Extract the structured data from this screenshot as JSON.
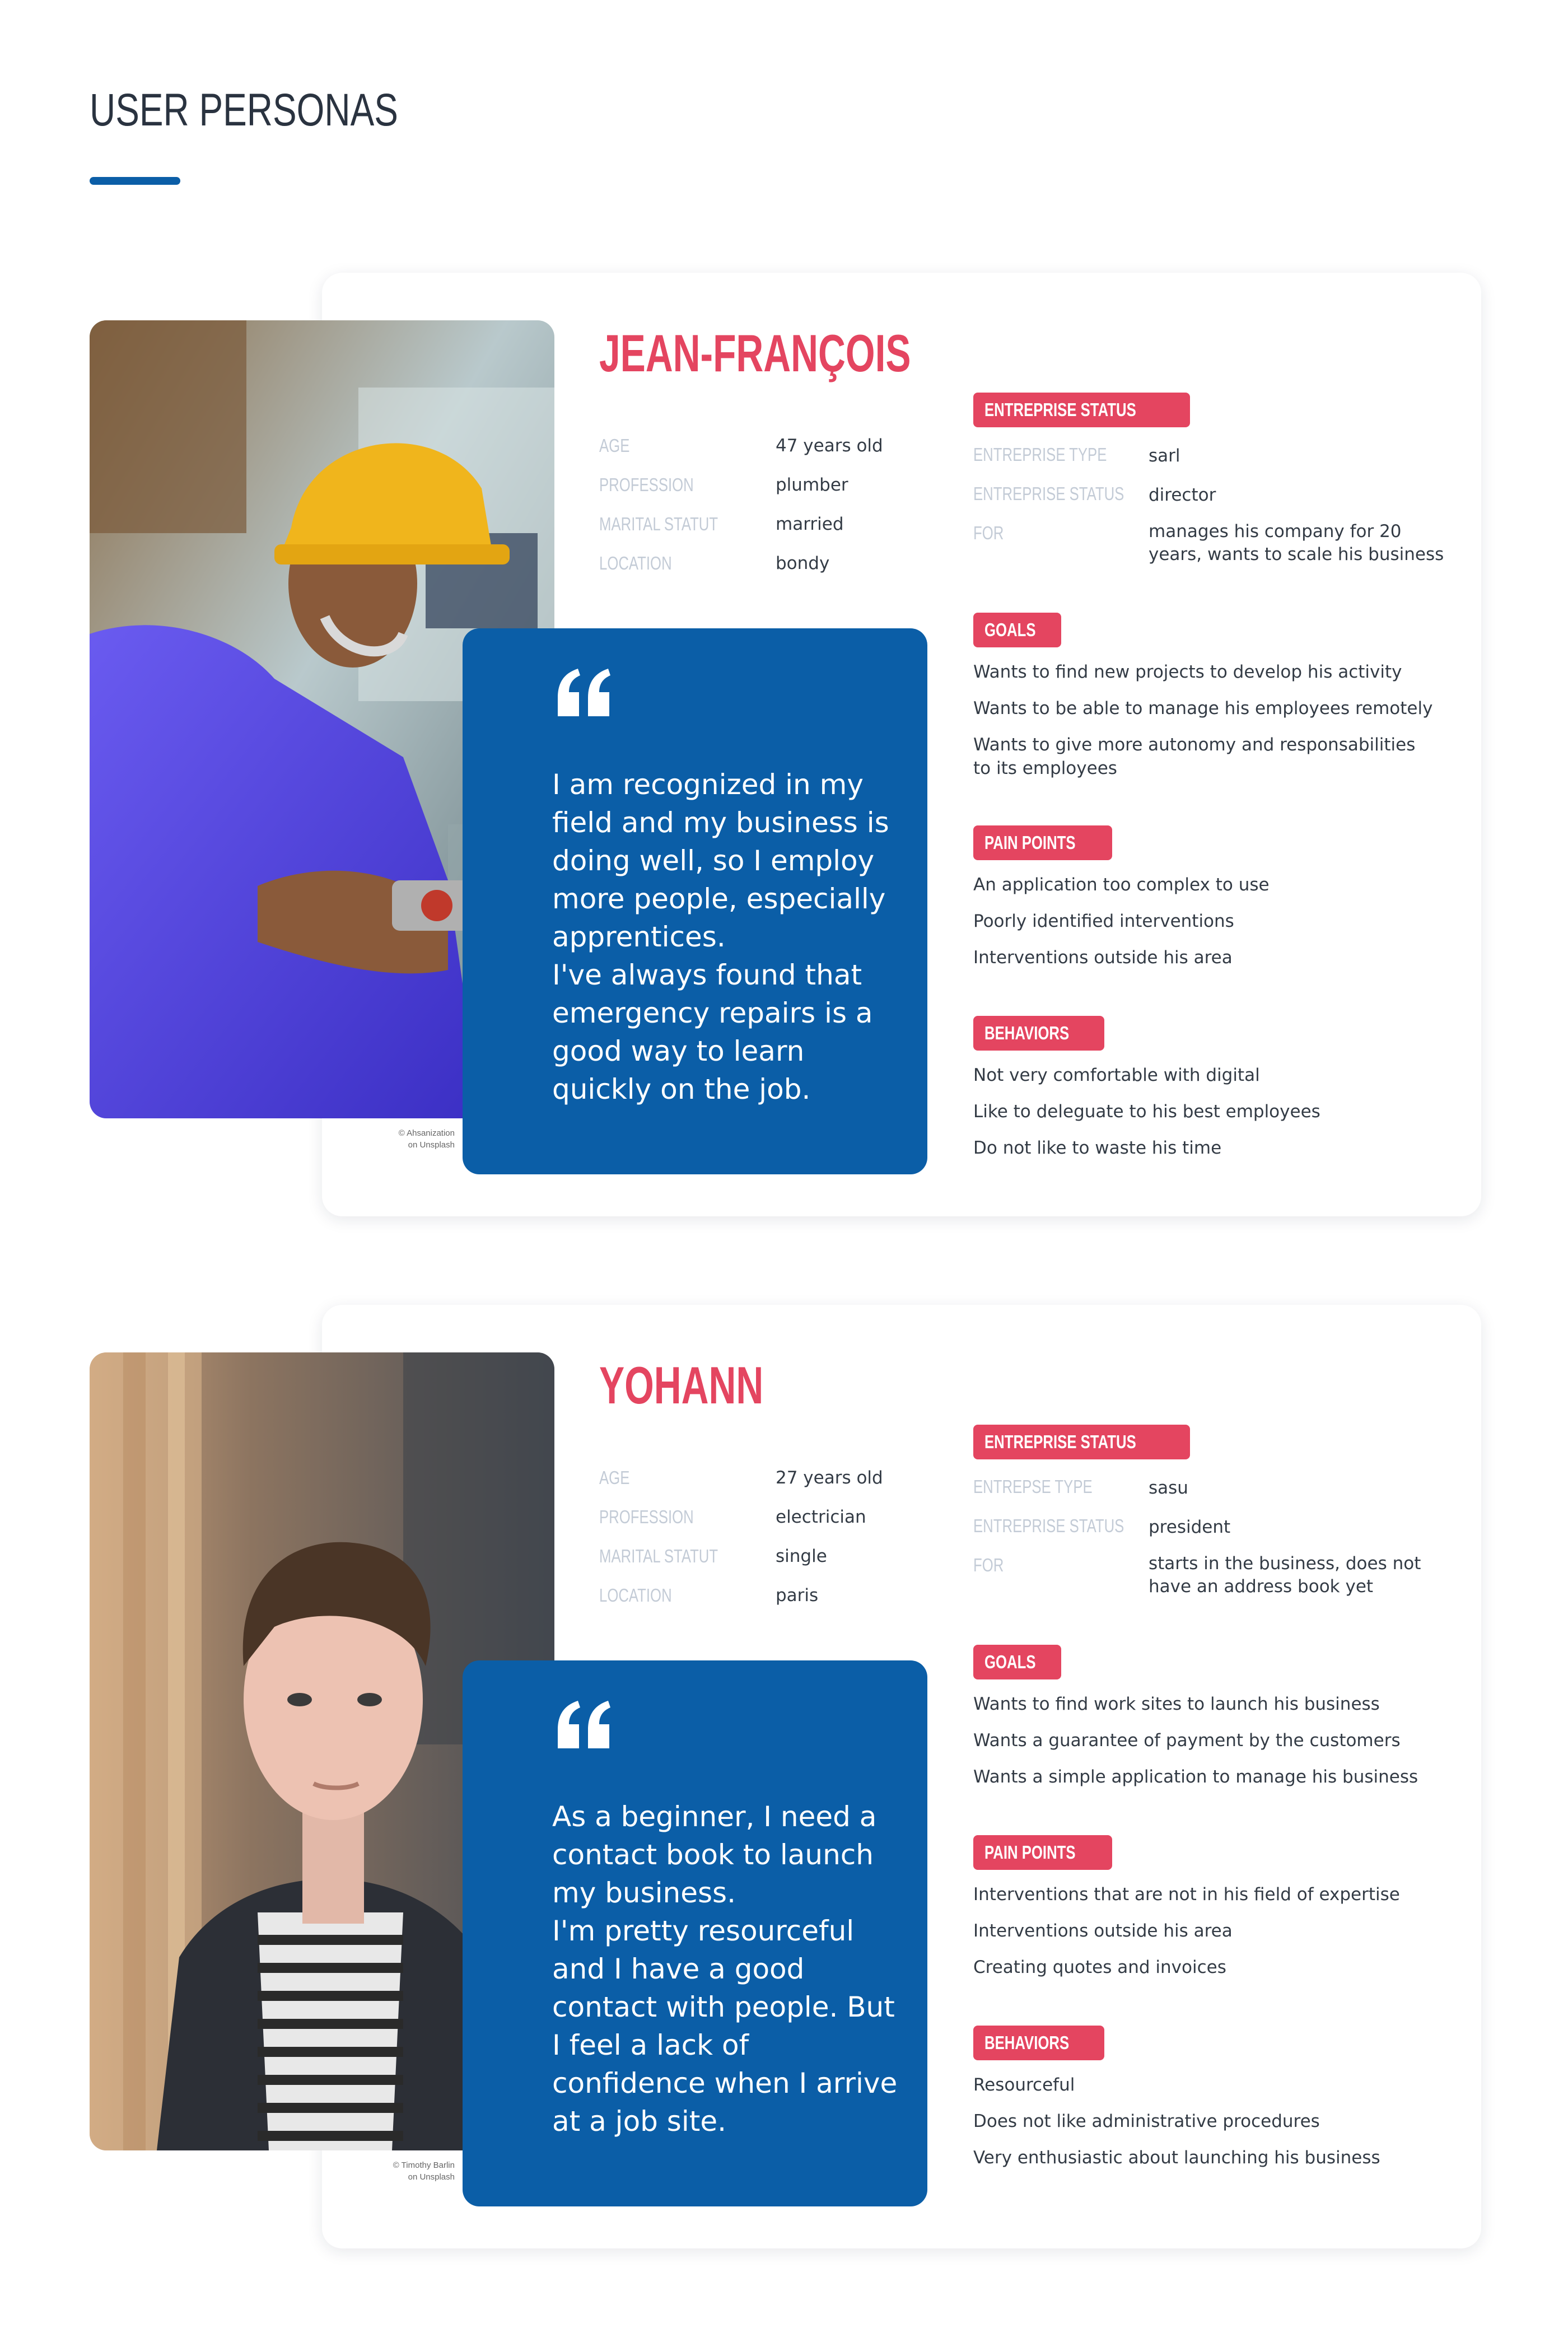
{
  "page": {
    "title": "USER PERSONAS"
  },
  "labels": {
    "age": "AGE",
    "profession": "PROFESSION",
    "marital": "MARITAL STATUT",
    "location": "LOCATION",
    "entreprise_status_tag": "ENTREPRISE STATUS",
    "for": "FOR",
    "goals_tag": "GOALS",
    "pain_points_tag": "PAIN POINTS",
    "behaviors_tag": "BEHAVIORS"
  },
  "personas": [
    {
      "name": "JEAN-FRANÇOIS",
      "age": "47 years old",
      "profession": "plumber",
      "marital": "married",
      "location": "bondy",
      "entreprise_type_label": "ENTREPRISE TYPE",
      "entreprise_status_label": "ENTREPRISE STATUS",
      "entreprise_type": "sarl",
      "entreprise_status": "director",
      "for": "manages his company for 20 years, wants to scale his business",
      "goals": [
        "Wants to find new projects to develop his activity",
        "Wants to be able to manage his employees remotely",
        "Wants to give more autonomy and responsabilities to its employees"
      ],
      "pain_points": [
        "An application too complex to use",
        "Poorly identified interventions",
        "Interventions outside his area"
      ],
      "behaviors": [
        "Not very comfortable with digital",
        "Like to deleguate to his best employees",
        "Do not like to waste his time"
      ],
      "quote": "I am recognized in my field and my business is doing well, so I employ more people, especially apprentices.\nI've always found that emergency repairs is a good way to learn quickly on the job.",
      "credit": "© Ahsanization\non Unsplash"
    },
    {
      "name": "YOHANN",
      "age": "27 years old",
      "profession": "electrician",
      "marital": "single",
      "location": "paris",
      "entreprise_type_label": "ENTREPSE TYPE",
      "entreprise_status_label": "ENTREPRISE STATUS",
      "entreprise_type": "sasu",
      "entreprise_status": "president",
      "for": "starts in the business, does not have an address book yet",
      "goals": [
        "Wants to find work sites to launch his business",
        "Wants a guarantee of payment by the customers",
        "Wants a simple application to manage his business"
      ],
      "pain_points": [
        "Interventions that are not in his field of expertise",
        "Interventions outside his area",
        "Creating quotes and invoices"
      ],
      "behaviors": [
        "Resourceful",
        "Does not like administrative procedures",
        "Very enthusiastic about launching his business"
      ],
      "quote": "As a beginner, I need a contact book to launch my business.\nI'm pretty resourceful and I have a good contact with people. But I feel a lack of confidence when I arrive at a job site.",
      "credit": "© Timothy Barlin\non Unsplash"
    }
  ],
  "colors": {
    "accent_blue": "#0b5ea7",
    "accent_red": "#e44560",
    "label_gray": "#c3cbd6",
    "text_dark": "#333b45"
  },
  "icons": {
    "quote": "quote-icon"
  }
}
